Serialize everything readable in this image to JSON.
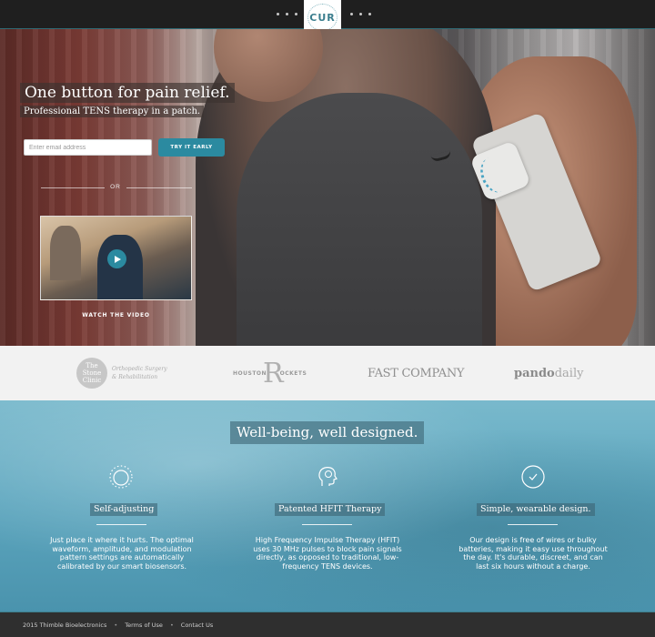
{
  "nav": {
    "logo": "CUR",
    "colors": {
      "bar": "#1f1f1f",
      "accent": "#2b8aa0"
    }
  },
  "hero": {
    "headline": "One button for pain relief.",
    "subheadline": "Professional TENS therapy in a patch.",
    "email_placeholder": "Enter email address",
    "cta_label": "TRY IT EARLY",
    "divider_label": "OR",
    "video_label": "WATCH THE VIDEO",
    "icons": {
      "play": "play-icon"
    }
  },
  "press": {
    "stone_clinic": {
      "name": "The Stone Clinic",
      "tagline_line1": "Orthopedic Surgery",
      "tagline_line2": "& Rehabilitation"
    },
    "houston_rockets": {
      "left": "HOUSTON",
      "mark": "R",
      "right": "OCKETS"
    },
    "fast_company": "FAST COMPANY",
    "pando": {
      "bold": "pando",
      "light": "daily"
    }
  },
  "features": {
    "title": "Well-being, well designed.",
    "items": [
      {
        "icon": "dotted-circle-icon",
        "title": "Self-adjusting",
        "text": "Just place it where it hurts.  The optimal waveform, amplitude, and modulation pattern settings are automatically calibrated by our smart biosensors."
      },
      {
        "icon": "head-profile-icon",
        "title": "Patented HFIT Therapy",
        "text": "High Frequency Impulse Therapy (HFIT) uses 30 MHz pulses to block pain signals directly, as opposed to traditional, low-frequency TENS devices."
      },
      {
        "icon": "checkmark-circle-icon",
        "title": "Simple, wearable design.",
        "text": "Our design is free of wires or bulky batteries, making it easy use throughout the day. It's durable, discreet, and can last six hours without a charge."
      }
    ]
  },
  "footer": {
    "copyright": "2015 Thimble Bioelectronics",
    "sep1": "•",
    "terms": "Terms of Use",
    "sep2": "•",
    "contact": "Contact Us"
  }
}
